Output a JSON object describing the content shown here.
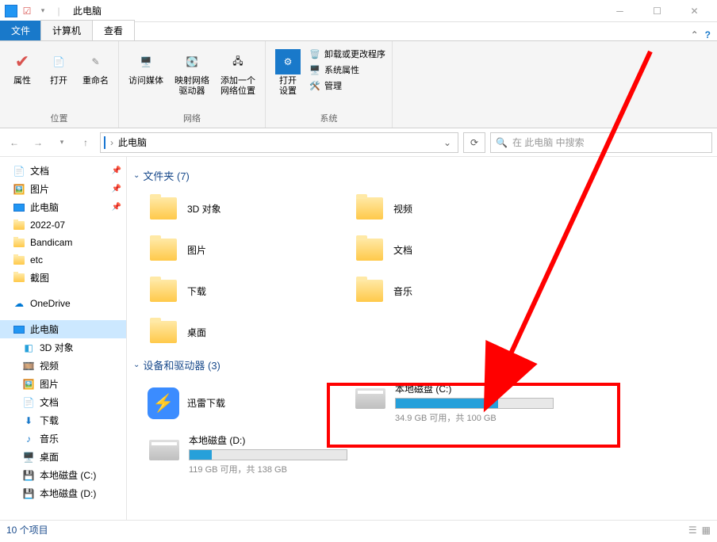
{
  "titlebar": {
    "title": "此电脑"
  },
  "tabs": {
    "file": "文件",
    "computer": "计算机",
    "view": "查看"
  },
  "ribbon": {
    "group1_label": "位置",
    "properties": "属性",
    "open": "打开",
    "rename": "重命名",
    "group2_label": "网络",
    "access_media": "访问媒体",
    "map_drive": "映射网络\n驱动器",
    "add_loc": "添加一个\n网络位置",
    "group3_label": "系统",
    "open_settings": "打开\n设置",
    "uninstall": "卸载或更改程序",
    "sys_props": "系统属性",
    "manage": "管理"
  },
  "address": {
    "location": "此电脑",
    "search_placeholder": "在 此电脑 中搜索"
  },
  "sidebar": {
    "items": [
      {
        "label": "文档",
        "icon": "doc",
        "pin": true
      },
      {
        "label": "图片",
        "icon": "pic",
        "pin": true
      },
      {
        "label": "此电脑",
        "icon": "pc",
        "pin": true
      },
      {
        "label": "2022-07",
        "icon": "folder"
      },
      {
        "label": "Bandicam",
        "icon": "folder"
      },
      {
        "label": "etc",
        "icon": "folder"
      },
      {
        "label": "截图",
        "icon": "folder"
      }
    ],
    "onedrive": "OneDrive",
    "thispc": "此电脑",
    "pc_children": [
      {
        "label": "3D 对象",
        "icon": "3d"
      },
      {
        "label": "视频",
        "icon": "video"
      },
      {
        "label": "图片",
        "icon": "pic"
      },
      {
        "label": "文档",
        "icon": "doc"
      },
      {
        "label": "下载",
        "icon": "dl"
      },
      {
        "label": "音乐",
        "icon": "music"
      },
      {
        "label": "桌面",
        "icon": "desktop"
      },
      {
        "label": "本地磁盘 (C:)",
        "icon": "disk"
      },
      {
        "label": "本地磁盘 (D:)",
        "icon": "disk"
      }
    ]
  },
  "content": {
    "folders_header": "文件夹 (7)",
    "folders": [
      {
        "label": "3D 对象"
      },
      {
        "label": "视频"
      },
      {
        "label": "图片"
      },
      {
        "label": "文档"
      },
      {
        "label": "下载"
      },
      {
        "label": "音乐"
      },
      {
        "label": "桌面"
      }
    ],
    "drives_header": "设备和驱动器 (3)",
    "thunder": "迅雷下载",
    "drive_c": {
      "name": "本地磁盘 (C:)",
      "status": "34.9 GB 可用，共 100 GB",
      "pct": 65
    },
    "drive_d": {
      "name": "本地磁盘 (D:)",
      "status": "119 GB 可用，共 138 GB",
      "pct": 14
    }
  },
  "statusbar": {
    "count": "10 个项目"
  }
}
